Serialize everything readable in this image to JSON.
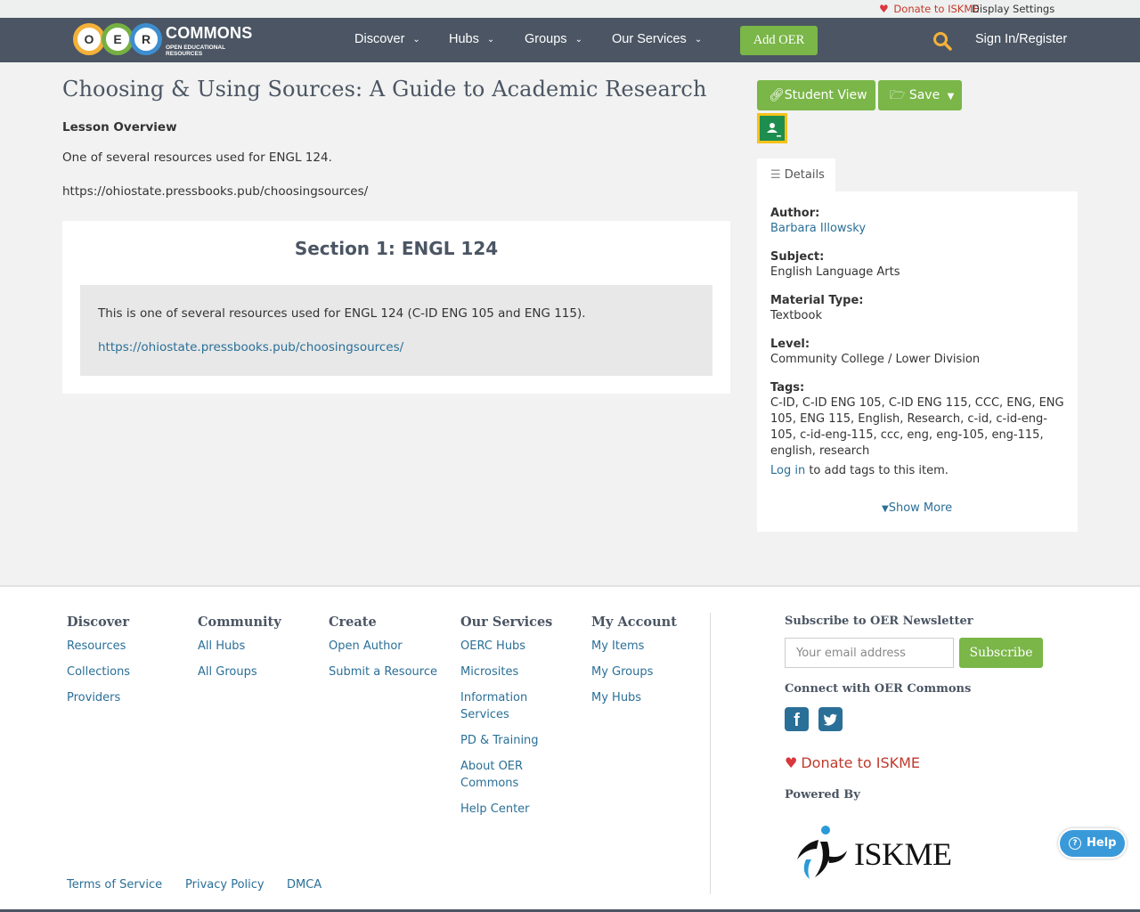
{
  "utility": {
    "donate": "Donate to ISKME",
    "display_settings": "Display Settings"
  },
  "nav": {
    "logo_letters": [
      "O",
      "E",
      "R"
    ],
    "logo_word": "COMMONS",
    "logo_sub": "OPEN EDUCATIONAL RESOURCES",
    "items": [
      "Discover",
      "Hubs",
      "Groups",
      "Our Services"
    ],
    "add_oer": "Add OER",
    "sign_in": "Sign In/Register"
  },
  "resource": {
    "title": "Choosing & Using Sources: A Guide to Academic Research",
    "overview_heading": "Lesson Overview",
    "overview_text": "One of several resources used for ENGL 124.",
    "overview_url": "https://ohiostate.pressbooks.pub/choosingsources/",
    "section_title": "Section 1: ENGL 124",
    "section_text": "This is one of several resources used for ENGL 124 (C-ID ENG 105 and ENG 115).",
    "section_link": "https://ohiostate.pressbooks.pub/choosingsources/"
  },
  "actions": {
    "student_view": "Student View",
    "save": "Save"
  },
  "details": {
    "tab": "Details",
    "author_label": "Author:",
    "author": "Barbara Illowsky",
    "subject_label": "Subject:",
    "subject": "English Language Arts",
    "material_label": "Material Type:",
    "material": "Textbook",
    "level_label": "Level:",
    "level": "Community College / Lower Division",
    "tags_label": "Tags:",
    "tags": "C-ID, C-ID ENG 105, C-ID ENG 115, CCC, ENG, ENG 105, ENG 115, English, Research, c-id, c-id-eng-105, c-id-eng-115, ccc, eng, eng-105, eng-115, english, research",
    "login_link": "Log in",
    "login_suffix": " to add tags to this item.",
    "show_more": "Show More"
  },
  "footer": {
    "discover": {
      "heading": "Discover",
      "links": [
        "Resources",
        "Collections",
        "Providers"
      ]
    },
    "community": {
      "heading": "Community",
      "links": [
        "All Hubs",
        "All Groups"
      ]
    },
    "create": {
      "heading": "Create",
      "links": [
        "Open Author",
        "Submit a Resource"
      ]
    },
    "services": {
      "heading": "Our Services",
      "links": [
        "OERC Hubs",
        "Microsites",
        "Information Services",
        "PD & Training",
        "About OER Commons",
        "Help Center"
      ]
    },
    "account": {
      "heading": "My Account",
      "links": [
        "My Items",
        "My Groups",
        "My Hubs"
      ]
    },
    "newsletter_heading": "Subscribe to OER Newsletter",
    "email_placeholder": "Your email address",
    "subscribe": "Subscribe",
    "connect_heading": "Connect with OER Commons",
    "donate": "Donate to ISKME",
    "powered_by": "Powered By",
    "iskme_logo_text": "ISKME",
    "help": "Help",
    "legal": [
      "Terms of Service",
      "Privacy Policy",
      "DMCA"
    ]
  },
  "colors": {
    "nav": "#4b5563",
    "green": "#7ab648",
    "link": "#2a6f97",
    "donate": "#c0392b"
  }
}
